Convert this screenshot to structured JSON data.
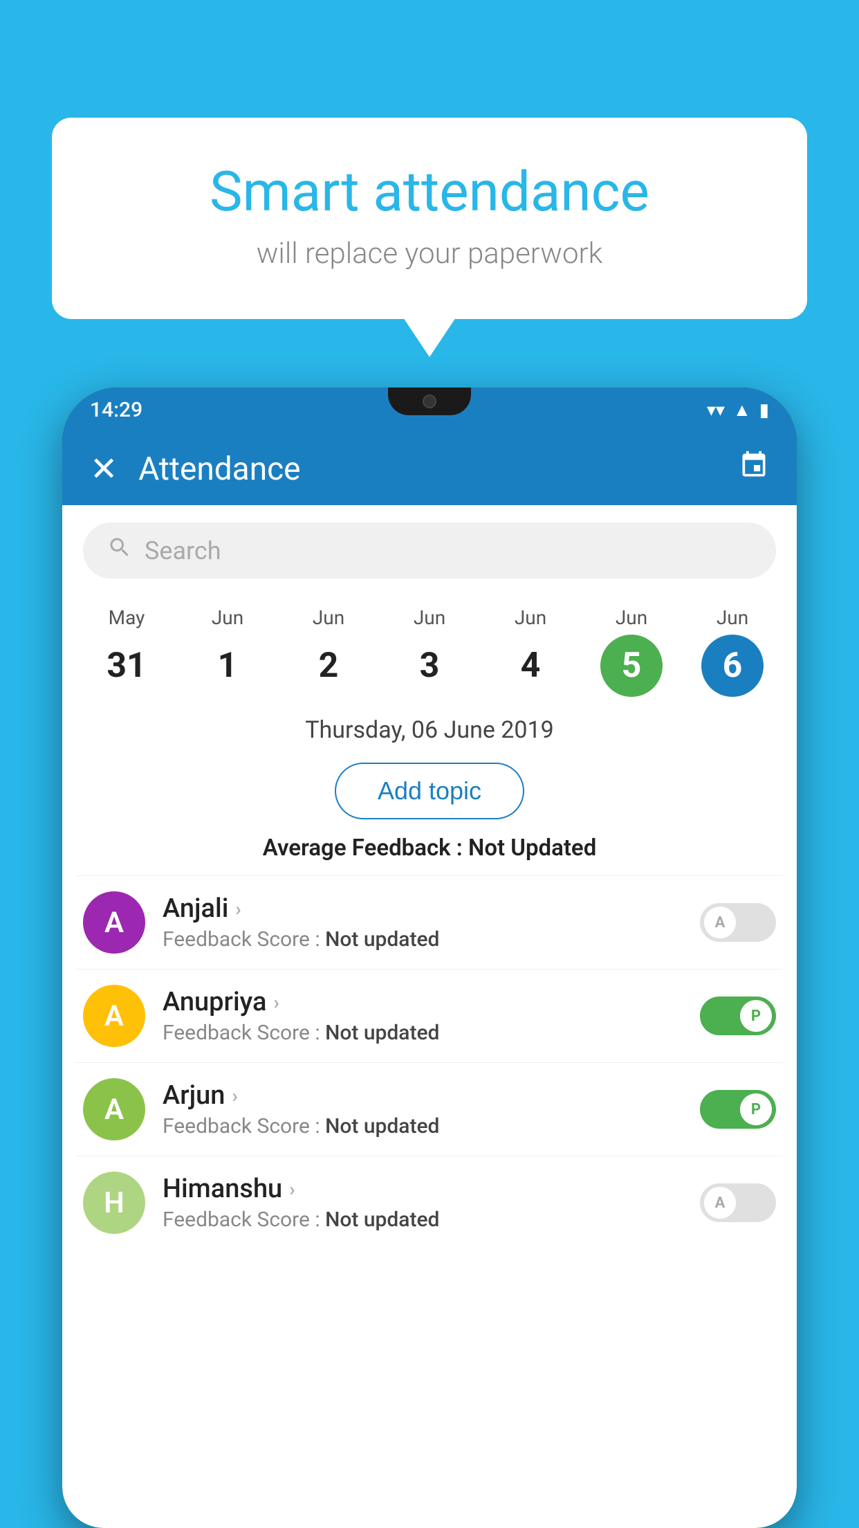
{
  "background_color": "#29b6e8",
  "bubble": {
    "title": "Smart attendance",
    "subtitle": "will replace your paperwork"
  },
  "status_bar": {
    "time": "14:29",
    "wifi_icon": "▼",
    "signal_icon": "▲",
    "battery_icon": "▮"
  },
  "app_header": {
    "title": "Attendance",
    "close_label": "✕",
    "calendar_label": "📅"
  },
  "search": {
    "placeholder": "Search"
  },
  "dates": [
    {
      "month": "May",
      "day": "31",
      "state": "normal"
    },
    {
      "month": "Jun",
      "day": "1",
      "state": "normal"
    },
    {
      "month": "Jun",
      "day": "2",
      "state": "normal"
    },
    {
      "month": "Jun",
      "day": "3",
      "state": "normal"
    },
    {
      "month": "Jun",
      "day": "4",
      "state": "normal"
    },
    {
      "month": "Jun",
      "day": "5",
      "state": "today"
    },
    {
      "month": "Jun",
      "day": "6",
      "state": "selected"
    }
  ],
  "selected_date_label": "Thursday, 06 June 2019",
  "add_topic_label": "Add topic",
  "avg_feedback": {
    "label": "Average Feedback : ",
    "value": "Not Updated"
  },
  "students": [
    {
      "name": "Anjali",
      "avatar_letter": "A",
      "avatar_color": "#9c27b0",
      "feedback_label": "Feedback Score : ",
      "feedback_value": "Not updated",
      "toggle_state": "off",
      "toggle_letter": "A"
    },
    {
      "name": "Anupriya",
      "avatar_letter": "A",
      "avatar_color": "#ffc107",
      "feedback_label": "Feedback Score : ",
      "feedback_value": "Not updated",
      "toggle_state": "on",
      "toggle_letter": "P"
    },
    {
      "name": "Arjun",
      "avatar_letter": "A",
      "avatar_color": "#8bc34a",
      "feedback_label": "Feedback Score : ",
      "feedback_value": "Not updated",
      "toggle_state": "on",
      "toggle_letter": "P"
    },
    {
      "name": "Himanshu",
      "avatar_letter": "H",
      "avatar_color": "#aed581",
      "feedback_label": "Feedback Score : ",
      "feedback_value": "Not updated",
      "toggle_state": "off",
      "toggle_letter": "A"
    }
  ]
}
